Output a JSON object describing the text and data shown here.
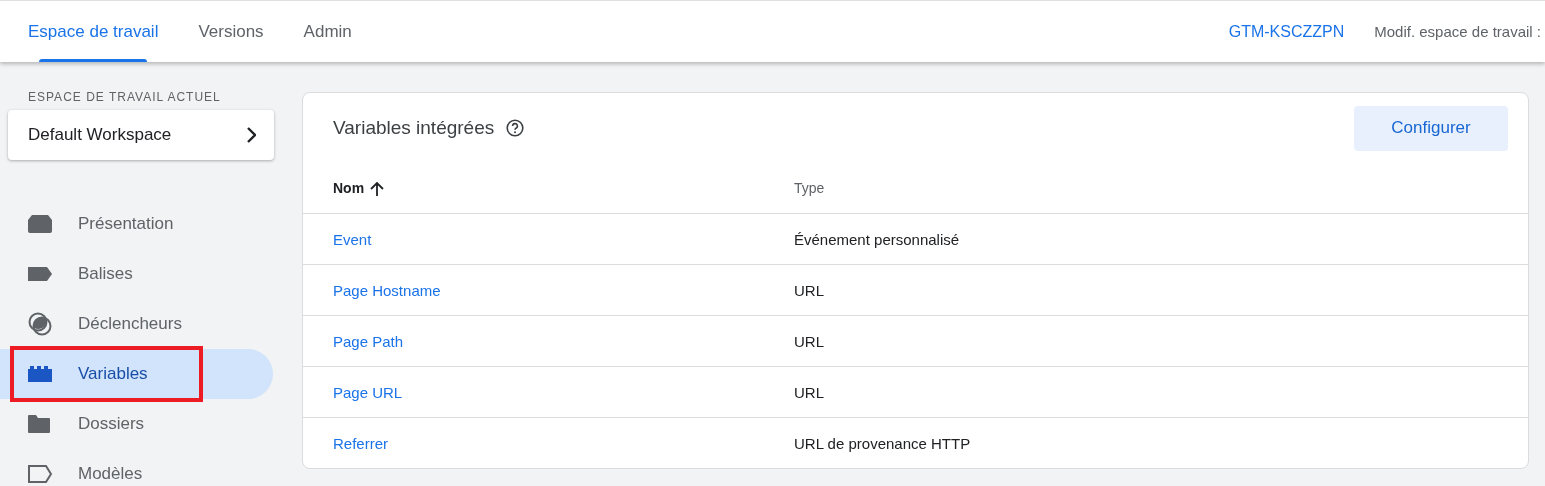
{
  "tabs": [
    {
      "label": "Espace de travail",
      "selected": true
    },
    {
      "label": "Versions",
      "selected": false
    },
    {
      "label": "Admin",
      "selected": false
    }
  ],
  "container_id": "GTM-KSCZZPN",
  "workspace_changes": "Modif. espace de travail :",
  "sidebar": {
    "section_label": "ESPACE DE TRAVAIL ACTUEL",
    "workspace": "Default Workspace",
    "items": [
      {
        "kind": "overview",
        "label": "Présentation",
        "selected": false,
        "highlighted": false
      },
      {
        "kind": "tags",
        "label": "Balises",
        "selected": false,
        "highlighted": false
      },
      {
        "kind": "triggers",
        "label": "Déclencheurs",
        "selected": false,
        "highlighted": false
      },
      {
        "kind": "variables",
        "label": "Variables",
        "selected": true,
        "highlighted": true
      },
      {
        "kind": "folders",
        "label": "Dossiers",
        "selected": false,
        "highlighted": false
      },
      {
        "kind": "templates",
        "label": "Modèles",
        "selected": false,
        "highlighted": false
      }
    ]
  },
  "card": {
    "title": "Variables intégrées",
    "button": "Configurer",
    "columns": [
      "Nom",
      "Type"
    ],
    "rows": [
      {
        "name": "Event",
        "type": "Événement personnalisé"
      },
      {
        "name": "Page Hostname",
        "type": "URL"
      },
      {
        "name": "Page Path",
        "type": "URL"
      },
      {
        "name": "Page URL",
        "type": "URL"
      },
      {
        "name": "Referrer",
        "type": "URL de provenance HTTP"
      }
    ]
  }
}
